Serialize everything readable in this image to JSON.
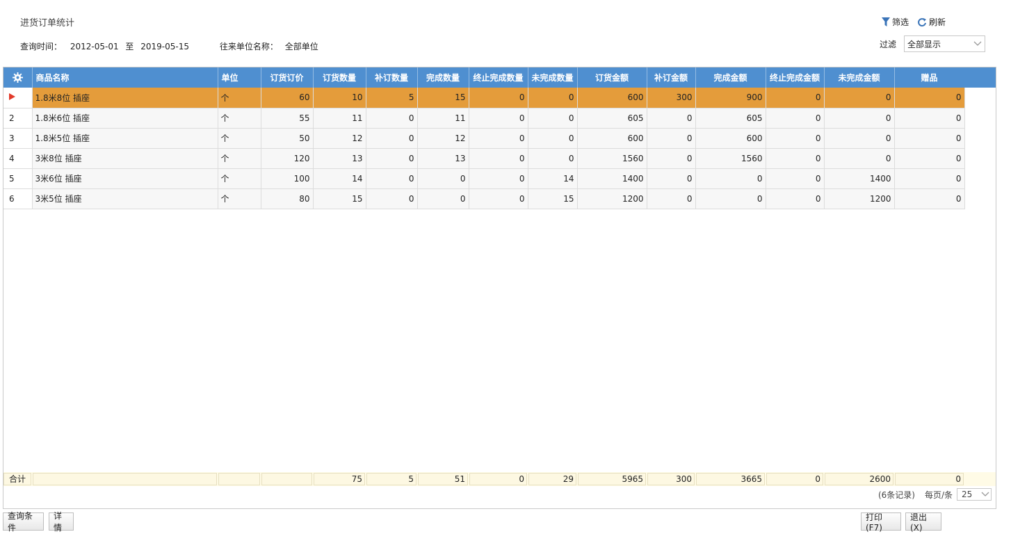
{
  "page": {
    "title": "进货订单统计"
  },
  "query": {
    "time_label": "查询时间：",
    "from": "2012-05-01",
    "to_label": "至",
    "to": "2019-05-15",
    "partner_label": "往来单位名称：",
    "partner_value": "全部单位"
  },
  "tools": {
    "filter_label": "筛选",
    "refresh_label": "刷新"
  },
  "filter": {
    "label": "过滤",
    "value": "全部显示"
  },
  "grid": {
    "columns": [
      "商品名称",
      "单位",
      "订货订价",
      "订货数量",
      "补订数量",
      "完成数量",
      "终止完成数量",
      "未完成数量",
      "订货金额",
      "补订金额",
      "完成金额",
      "终止完成金额",
      "未完成金额",
      "赠品"
    ],
    "rows": [
      {
        "idx": "",
        "name": "1.8米8位 插座",
        "unit": "个",
        "price": "60",
        "qty": "10",
        "add_qty": "5",
        "done_qty": "15",
        "stop_qty": "0",
        "undone_qty": "0",
        "amount": "600",
        "add_amount": "300",
        "done_amount": "900",
        "stop_amount": "0",
        "undone_amount": "0",
        "gift": "0"
      },
      {
        "idx": "2",
        "name": "1.8米6位 插座",
        "unit": "个",
        "price": "55",
        "qty": "11",
        "add_qty": "0",
        "done_qty": "11",
        "stop_qty": "0",
        "undone_qty": "0",
        "amount": "605",
        "add_amount": "0",
        "done_amount": "605",
        "stop_amount": "0",
        "undone_amount": "0",
        "gift": "0"
      },
      {
        "idx": "3",
        "name": "1.8米5位 插座",
        "unit": "个",
        "price": "50",
        "qty": "12",
        "add_qty": "0",
        "done_qty": "12",
        "stop_qty": "0",
        "undone_qty": "0",
        "amount": "600",
        "add_amount": "0",
        "done_amount": "600",
        "stop_amount": "0",
        "undone_amount": "0",
        "gift": "0"
      },
      {
        "idx": "4",
        "name": "3米8位 插座",
        "unit": "个",
        "price": "120",
        "qty": "13",
        "add_qty": "0",
        "done_qty": "13",
        "stop_qty": "0",
        "undone_qty": "0",
        "amount": "1560",
        "add_amount": "0",
        "done_amount": "1560",
        "stop_amount": "0",
        "undone_amount": "0",
        "gift": "0"
      },
      {
        "idx": "5",
        "name": "3米6位 插座",
        "unit": "个",
        "price": "100",
        "qty": "14",
        "add_qty": "0",
        "done_qty": "0",
        "stop_qty": "0",
        "undone_qty": "14",
        "amount": "1400",
        "add_amount": "0",
        "done_amount": "0",
        "stop_amount": "0",
        "undone_amount": "1400",
        "gift": "0"
      },
      {
        "idx": "6",
        "name": "3米5位 插座",
        "unit": "个",
        "price": "80",
        "qty": "15",
        "add_qty": "0",
        "done_qty": "0",
        "stop_qty": "0",
        "undone_qty": "15",
        "amount": "1200",
        "add_amount": "0",
        "done_amount": "0",
        "stop_amount": "0",
        "undone_amount": "1200",
        "gift": "0"
      }
    ],
    "totals": {
      "label": "合计",
      "qty": "75",
      "add_qty": "5",
      "done_qty": "51",
      "stop_qty": "0",
      "undone_qty": "29",
      "amount": "5965",
      "add_amount": "300",
      "done_amount": "3665",
      "stop_amount": "0",
      "undone_amount": "2600",
      "gift": "0"
    }
  },
  "pager": {
    "records": "(6条记录)",
    "per_page_label": "每页/条",
    "per_page": "25"
  },
  "buttons": {
    "query_conditions": "查询条件",
    "details": "详情",
    "print": "打印(F7)",
    "exit": "退出(X)"
  },
  "colors": {
    "header": "#4f8fd0",
    "selected_row": "#e49c3b",
    "total_row": "#fdf8e2"
  }
}
